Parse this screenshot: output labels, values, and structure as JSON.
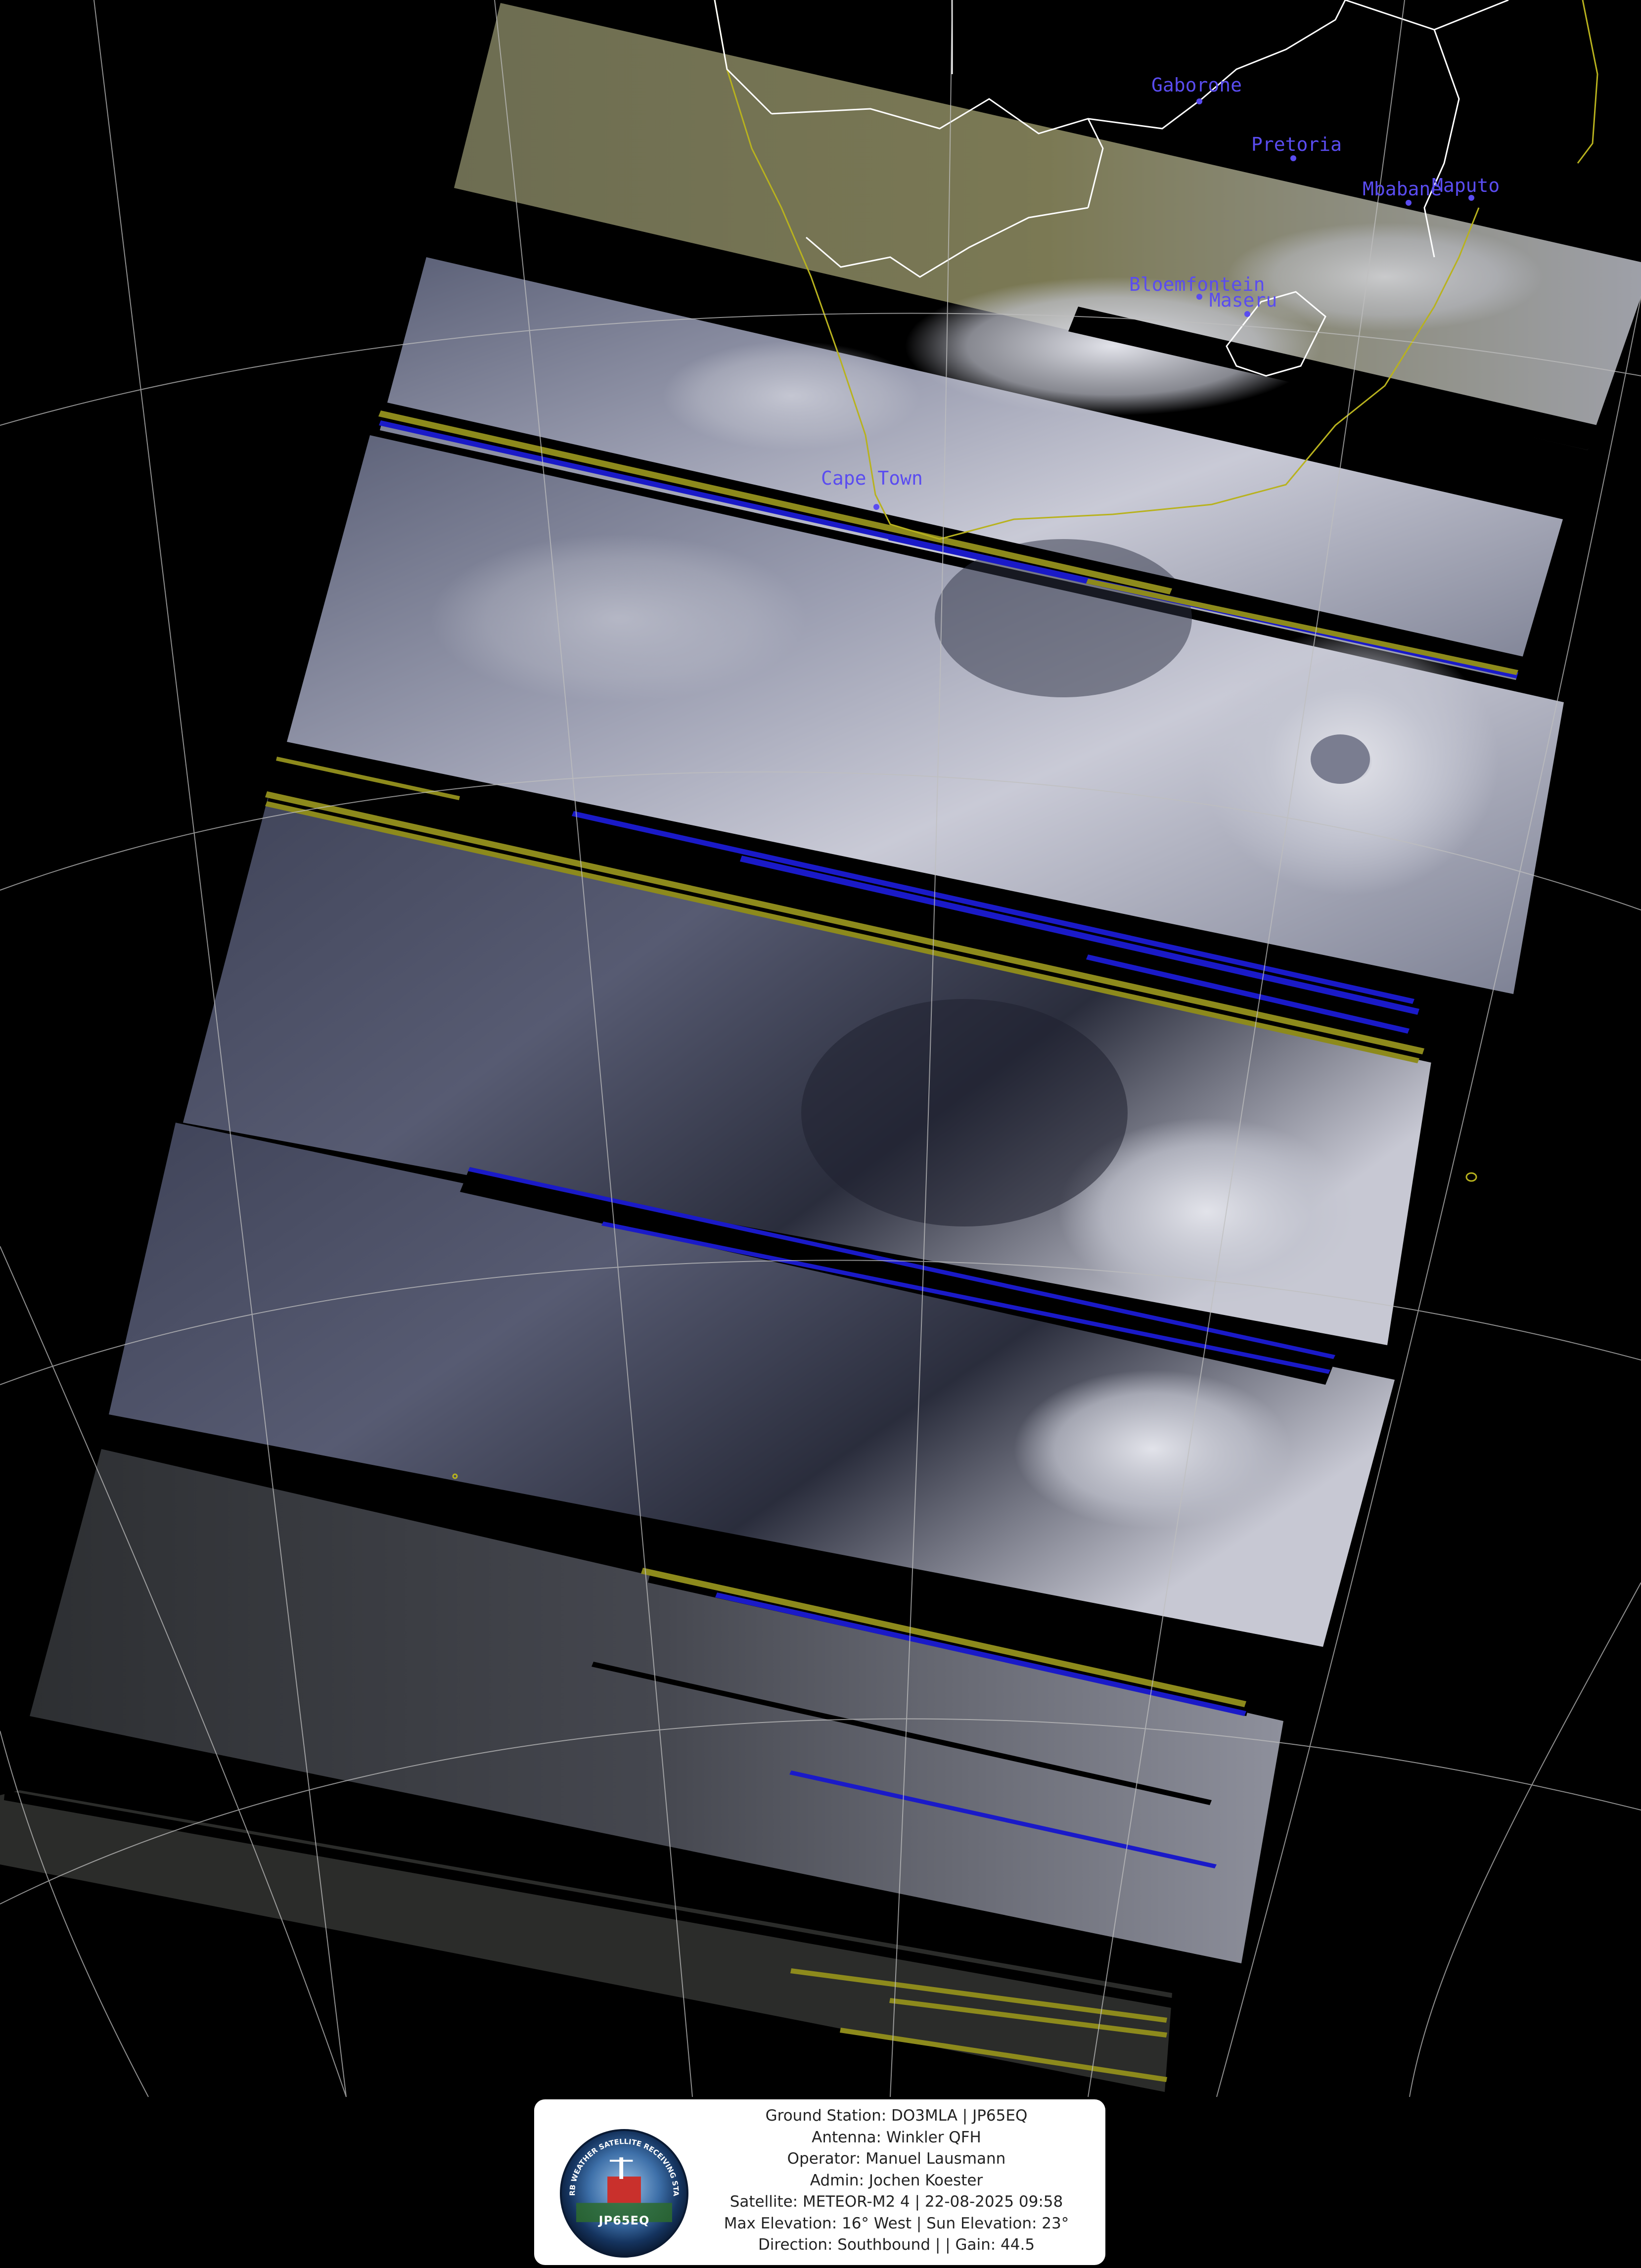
{
  "image": {
    "description_free": true,
    "colors": {
      "background": "#000000",
      "graticule": "#bfbfbf",
      "coastline": "#b8b21e",
      "borders": "#ffffff",
      "city_labels": "#5a4cf0",
      "dropout_yellow": "#8d8a1c",
      "dropout_blue": "#1a1ac8"
    }
  },
  "cities": [
    {
      "name": "Gaborone"
    },
    {
      "name": "Pretoria"
    },
    {
      "name": "Mbabane"
    },
    {
      "name": "Maputo"
    },
    {
      "name": "Bloemfontein"
    },
    {
      "name": "Maseru"
    },
    {
      "name": "Cape Town"
    }
  ],
  "info": {
    "logo_text": "JP65EQ",
    "logo_ring_text": "DF ORB WEATHER SATELLITE RECEIVING STATION",
    "lines": [
      "Ground Station: DO3MLA | JP65EQ",
      "Antenna: Winkler QFH",
      "Operator: Manuel Lausmann",
      "Admin: Jochen Koester",
      "Satellite: METEOR-M2 4 | 22-08-2025 09:58",
      "Max Elevation: 16° West | Sun Elevation: 23°",
      "Direction: Southbound | | Gain: 44.5"
    ]
  }
}
